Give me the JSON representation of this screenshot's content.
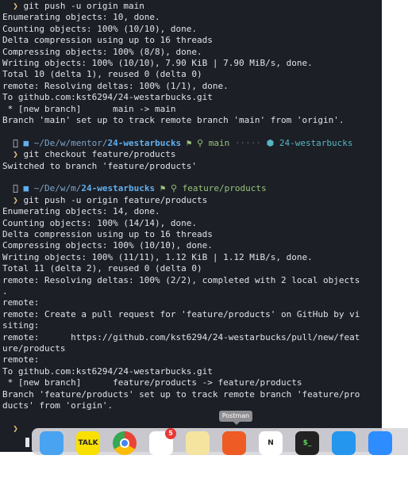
{
  "terminal": {
    "lines": [
      {
        "type": "cmd",
        "text": "git push -u origin main"
      },
      {
        "type": "out",
        "text": "Enumerating objects: 10, done."
      },
      {
        "type": "out",
        "text": "Counting objects: 100% (10/10), done."
      },
      {
        "type": "out",
        "text": "Delta compression using up to 16 threads"
      },
      {
        "type": "out",
        "text": "Compressing objects: 100% (8/8), done."
      },
      {
        "type": "out",
        "text": "Writing objects: 100% (10/10), 7.90 KiB | 7.90 MiB/s, done."
      },
      {
        "type": "out",
        "text": "Total 10 (delta 1), reused 0 (delta 0)"
      },
      {
        "type": "out",
        "text": "remote: Resolving deltas: 100% (1/1), done."
      },
      {
        "type": "out",
        "text": "To github.com:kst6294/24-westarbucks.git"
      },
      {
        "type": "out",
        "text": " * [new branch]      main -> main"
      },
      {
        "type": "out",
        "text": "Branch 'main' set up to track remote branch 'main' from 'origin'."
      },
      {
        "type": "blank",
        "text": ""
      },
      {
        "type": "prompt",
        "path": "~/De/w/mentor/",
        "dir": "24-westarbucks",
        "branch": "main",
        "dots": "·····",
        "repo": "24-westarbucks"
      },
      {
        "type": "cmd",
        "text": "git checkout feature/products"
      },
      {
        "type": "out",
        "text": "Switched to branch 'feature/products'"
      },
      {
        "type": "blank",
        "text": ""
      },
      {
        "type": "prompt",
        "path": "~/De/w/m/",
        "dir": "24-westarbucks",
        "branch": "feature/products",
        "dots": "",
        "repo": ""
      },
      {
        "type": "cmd",
        "text": "git push -u origin feature/products"
      },
      {
        "type": "out",
        "text": "Enumerating objects: 14, done."
      },
      {
        "type": "out",
        "text": "Counting objects: 100% (14/14), done."
      },
      {
        "type": "out",
        "text": "Delta compression using up to 16 threads"
      },
      {
        "type": "out",
        "text": "Compressing objects: 100% (10/10), done."
      },
      {
        "type": "out",
        "text": "Writing objects: 100% (11/11), 1.12 KiB | 1.12 MiB/s, done."
      },
      {
        "type": "out",
        "text": "Total 11 (delta 2), reused 0 (delta 0)"
      },
      {
        "type": "out",
        "text": "remote: Resolving deltas: 100% (2/2), completed with 2 local objects"
      },
      {
        "type": "out",
        "text": "."
      },
      {
        "type": "out",
        "text": "remote:"
      },
      {
        "type": "out",
        "text": "remote: Create a pull request for 'feature/products' on GitHub by vi"
      },
      {
        "type": "out",
        "text": "siting:"
      },
      {
        "type": "out",
        "text": "remote:      https://github.com/kst6294/24-westarbucks/pull/new/feat"
      },
      {
        "type": "out",
        "text": "ure/products"
      },
      {
        "type": "out",
        "text": "remote:"
      },
      {
        "type": "out",
        "text": "To github.com:kst6294/24-westarbucks.git"
      },
      {
        "type": "out",
        "text": " * [new branch]      feature/products -> feature/products"
      },
      {
        "type": "out",
        "text": "Branch 'feature/products' set up to track remote branch 'feature/pro"
      },
      {
        "type": "out",
        "text": "ducts' from 'origin'."
      },
      {
        "type": "blank",
        "text": ""
      },
      {
        "type": "partial-prompt",
        "text": ""
      }
    ],
    "prompt_symbol": "❯"
  },
  "dock": {
    "tooltip": "Postman",
    "apps": [
      {
        "name": "finder",
        "label": "",
        "color": "#4aa3f0"
      },
      {
        "name": "kakaotalk",
        "label": "TALK",
        "color": "#f9e000"
      },
      {
        "name": "chrome",
        "label": "",
        "color": "#ffffff"
      },
      {
        "name": "slack",
        "label": "",
        "color": "#ffffff",
        "badge": "5"
      },
      {
        "name": "notes",
        "label": "",
        "color": "#f5e3a0"
      },
      {
        "name": "postman",
        "label": "",
        "color": "#ef5b25"
      },
      {
        "name": "notion",
        "label": "N",
        "color": "#ffffff"
      },
      {
        "name": "terminal",
        "label": "$_",
        "color": "#222222"
      },
      {
        "name": "docker",
        "label": "",
        "color": "#2496ed"
      },
      {
        "name": "zoom",
        "label": "",
        "color": "#2d8cff"
      }
    ]
  },
  "colors": {
    "terminal_bg": "#1c1f26",
    "text": "#dfe3ea",
    "prompt_arrow": "#e5c07b",
    "branch": "#98c379",
    "dir": "#61afef"
  }
}
